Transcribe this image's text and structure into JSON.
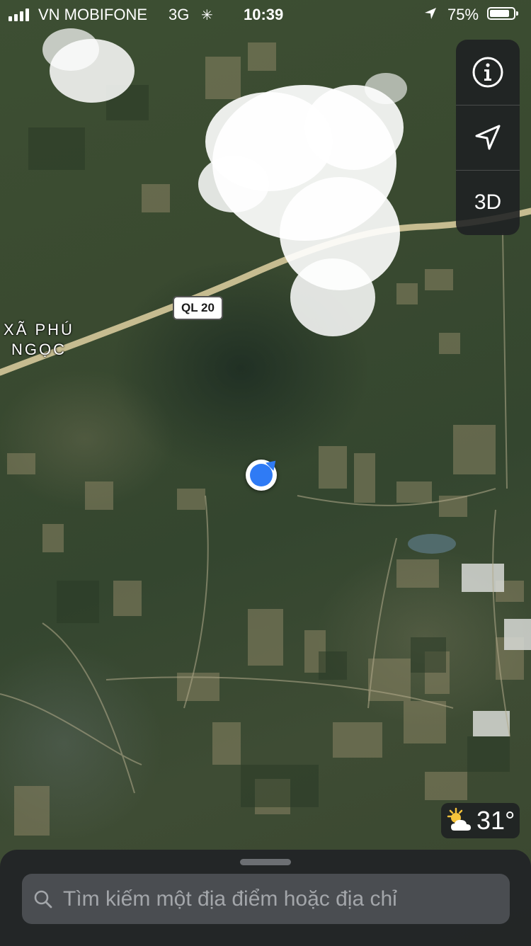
{
  "status_bar": {
    "carrier": "VN MOBIFONE",
    "network": "3G",
    "time": "10:39",
    "battery": "75%",
    "icons": [
      "signal-bars-icon",
      "activity-spinner-icon",
      "location-arrow-icon",
      "battery-icon"
    ]
  },
  "map": {
    "style": "satellite",
    "place_label": "XÃ PHÚ NGỌC",
    "road_label": "QL 20"
  },
  "controls": {
    "info_icon": "info-icon",
    "tracking_icon": "location-arrow-icon",
    "three_d_label": "3D"
  },
  "weather": {
    "icon": "partly-cloudy-icon",
    "temperature": "31°"
  },
  "search": {
    "placeholder": "Tìm kiếm một địa điểm hoặc địa chỉ",
    "icon": "search-icon"
  },
  "colors": {
    "user_location": "#2f7bf5",
    "panel": "#1e2022"
  }
}
